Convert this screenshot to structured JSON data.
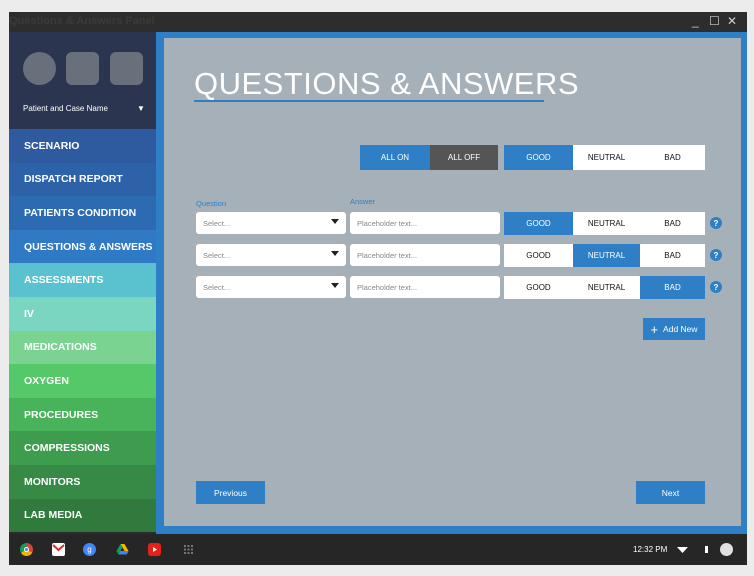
{
  "window": {
    "title": "Questions & Answers Panel"
  },
  "sidebar": {
    "patient_label": "Patient and Case Name",
    "items": [
      {
        "label": "SCENARIO",
        "color": "#2e5aa0"
      },
      {
        "label": "DISPATCH REPORT",
        "color": "#2d62a9"
      },
      {
        "label": "PATIENTS CONDITION",
        "color": "#2c6ab1"
      },
      {
        "label": "QUESTIONS & ANSWERS",
        "color": "#3079c4"
      },
      {
        "label": "ASSESSMENTS",
        "color": "#5ac2cf"
      },
      {
        "label": "IV",
        "color": "#7ad6c1"
      },
      {
        "label": "MEDICATIONS",
        "color": "#7bd392"
      },
      {
        "label": "OXYGEN",
        "color": "#55c96a"
      },
      {
        "label": "PROCEDURES",
        "color": "#48b35a"
      },
      {
        "label": "COMPRESSIONS",
        "color": "#3e9c4e"
      },
      {
        "label": "MONITORS",
        "color": "#378a46"
      },
      {
        "label": "LAB MEDIA",
        "color": "#2f7a3c"
      }
    ]
  },
  "main": {
    "title": "QUESTIONS & ANSWERS",
    "toggles": {
      "all_on": "ALL ON",
      "all_off": "ALL OFF",
      "good": "GOOD",
      "neutral": "NEUTRAL",
      "bad": "BAD"
    },
    "labels": {
      "question": "Question",
      "answer": "Answer"
    },
    "rows": [
      {
        "select": "Select...",
        "answer_placeholder": "Placeholder text...",
        "good": "GOOD",
        "neutral": "NEUTRAL",
        "bad": "BAD",
        "selected": "good",
        "help": "?"
      },
      {
        "select": "Select...",
        "answer_placeholder": "Placeholder text...",
        "good": "GOOD",
        "neutral": "NEUTRAL",
        "bad": "BAD",
        "selected": "neutral",
        "help": "?"
      },
      {
        "select": "Select...",
        "answer_placeholder": "Placeholder text...",
        "good": "GOOD",
        "neutral": "NEUTRAL",
        "bad": "BAD",
        "selected": "bad",
        "help": "?"
      }
    ],
    "add_new": "Add New",
    "previous": "Previous",
    "next": "Next"
  },
  "taskbar": {
    "apps": [
      "chrome-icon",
      "gmail-icon",
      "google-plus-icon",
      "drive-icon",
      "youtube-icon",
      "apps-grid-icon"
    ],
    "time": "12:32 PM"
  }
}
